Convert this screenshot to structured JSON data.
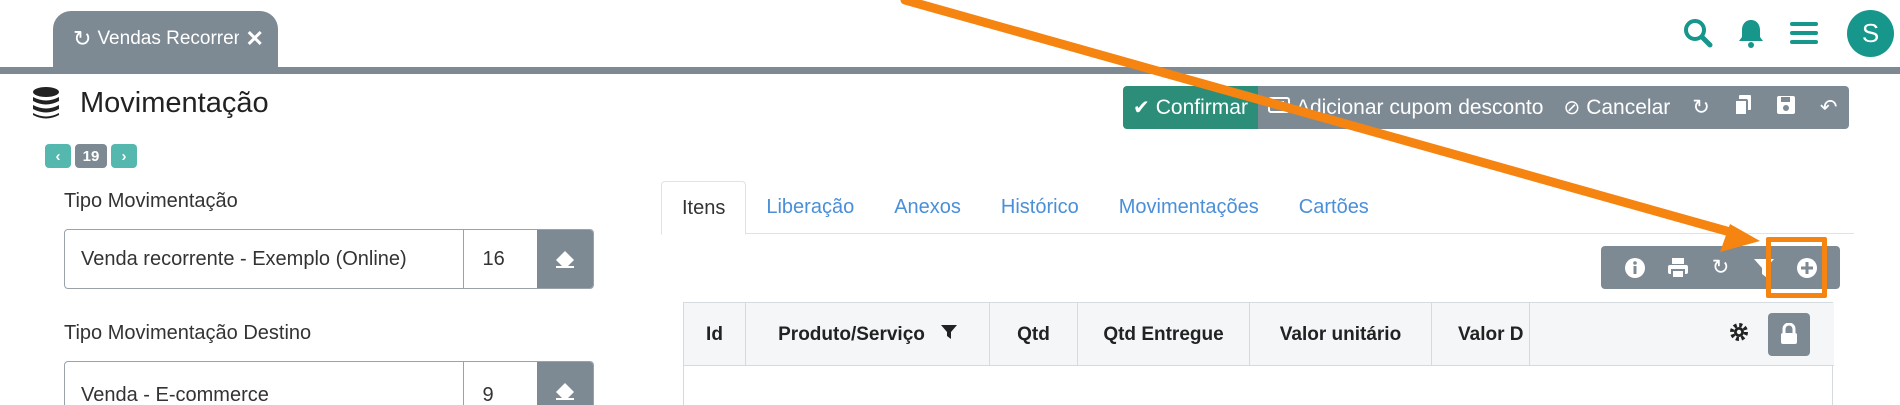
{
  "tab": {
    "icon": "refresh-icon",
    "label": "Vendas Recorrentes",
    "close_icon": "close-icon"
  },
  "top_icons": [
    "search-icon",
    "bell-icon",
    "menu-icon"
  ],
  "user": {
    "initial": "S"
  },
  "page": {
    "title": "Movimentação",
    "icon": "coins-icon"
  },
  "pager": {
    "prev_icon": "chevron-left-icon",
    "current": "19",
    "next_icon": "chevron-right-icon"
  },
  "actions": {
    "confirm": "Confirmar",
    "coupon": "Adicionar cupom desconto",
    "cancel": "Cancelar",
    "icons": [
      "refresh-icon",
      "copy-icon",
      "save-icon",
      "undo-icon"
    ]
  },
  "fields": [
    {
      "label": "Tipo Movimentação",
      "value": "Venda recorrente - Exemplo (Online)",
      "code": "16"
    },
    {
      "label": "Tipo Movimentação Destino",
      "value": "Venda - E-commerce",
      "code": "9"
    }
  ],
  "tabs": [
    "Itens",
    "Liberação",
    "Anexos",
    "Histórico",
    "Movimentações",
    "Cartões"
  ],
  "toolbar_icons": [
    "info-icon",
    "print-icon",
    "refresh-icon",
    "filter-icon",
    "add-circle-icon"
  ],
  "table": {
    "columns": [
      "Id",
      "Produto/Serviço",
      "Qtd",
      "Qtd Entregue",
      "Valor unitário",
      "Valor D"
    ]
  },
  "colors": {
    "teal": "#17968c",
    "grey": "#7d8a94",
    "confirm": "#2c8e78",
    "highlight": "#f58410",
    "link": "#4a8fd8"
  }
}
